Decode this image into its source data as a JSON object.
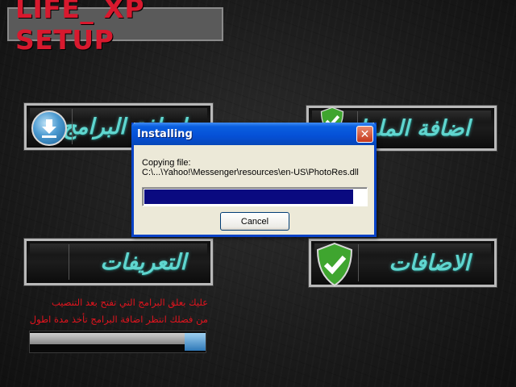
{
  "app": {
    "title": "LIFE_ XP SETUP"
  },
  "menu": {
    "add_programs": {
      "label": "اضافة البرامج",
      "icon": "download-icon"
    },
    "add_files": {
      "label": "اضافة الملفات",
      "icon": "shield-check-icon"
    },
    "drivers": {
      "label": "التعريفات"
    },
    "addons": {
      "label": "الاضافات",
      "icon": "shield-check-icon"
    }
  },
  "info": {
    "line1": "عليك بعلق البرامج التي تفتح بعد التنصيب",
    "line2": "من فضلك انتظر اضافة البرامج تأخذ مدة اطول"
  },
  "bottom_progress": {
    "fraction": 0.88
  },
  "dialog": {
    "title": "Installing",
    "close_label": "✕",
    "copying_label": "Copying file:",
    "copying_path": "C:\\...\\Yahoo!\\Messenger\\resources\\en-US\\PhotoRes.dll",
    "progress_fraction": 0.94,
    "cancel_label": "Cancel"
  },
  "colors": {
    "accent_teal": "#5fd6cf",
    "title_red": "#d8192e",
    "xp_blue": "#0550d6",
    "progress_navy": "#0a0a80"
  }
}
